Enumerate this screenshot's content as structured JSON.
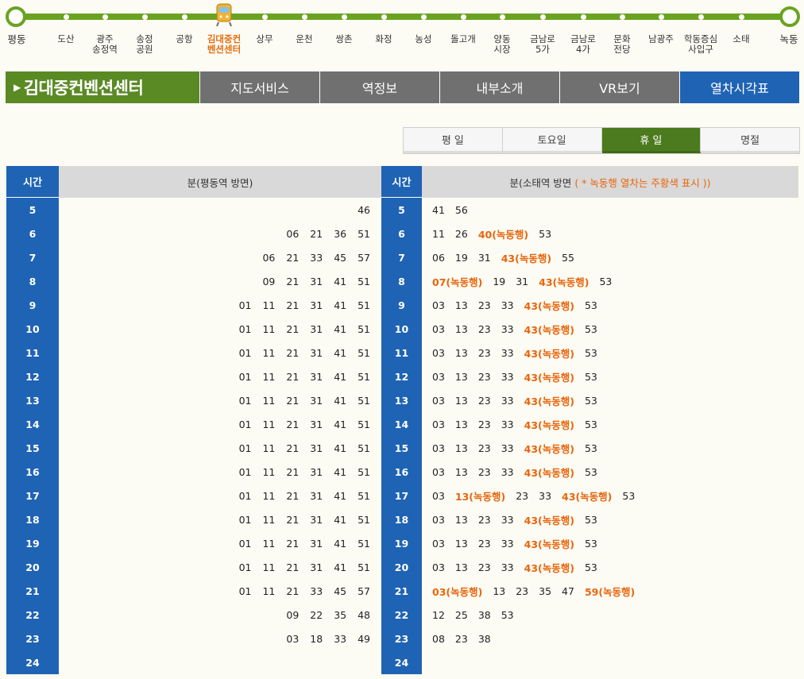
{
  "route": {
    "stations": [
      {
        "name": "평동",
        "end": true
      },
      {
        "name": "도산"
      },
      {
        "name": "광주\n송정역"
      },
      {
        "name": "송정\n공원"
      },
      {
        "name": "공항"
      },
      {
        "name": "김대중컨\n벤션센터",
        "current": true
      },
      {
        "name": "상무"
      },
      {
        "name": "운천"
      },
      {
        "name": "쌍촌"
      },
      {
        "name": "화정"
      },
      {
        "name": "농성"
      },
      {
        "name": "돌고개"
      },
      {
        "name": "양동\n시장"
      },
      {
        "name": "금남로\n5가"
      },
      {
        "name": "금남로\n4가"
      },
      {
        "name": "문화\n전당"
      },
      {
        "name": "남광주"
      },
      {
        "name": "학동증심\n사입구"
      },
      {
        "name": "소태"
      },
      {
        "name": "녹동",
        "end": true
      }
    ],
    "line_color": "#6aa321",
    "current_color": "#e46d0f"
  },
  "tabbar": {
    "station_title": "김대중컨벤션센터",
    "tabs": [
      {
        "label": "지도서비스"
      },
      {
        "label": "역정보"
      },
      {
        "label": "내부소개"
      },
      {
        "label": "VR보기"
      },
      {
        "label": "열차시각표",
        "active": true
      }
    ]
  },
  "days": [
    {
      "label": "평 일"
    },
    {
      "label": "토요일"
    },
    {
      "label": "휴 일",
      "active": true
    },
    {
      "label": "명절"
    }
  ],
  "left_table": {
    "hour_header": "시간",
    "min_header": "분(평동역 방면)",
    "rows": [
      {
        "hour": "5",
        "mins": [
          "46"
        ]
      },
      {
        "hour": "6",
        "mins": [
          "06",
          "21",
          "36",
          "51"
        ]
      },
      {
        "hour": "7",
        "mins": [
          "06",
          "21",
          "33",
          "45",
          "57"
        ]
      },
      {
        "hour": "8",
        "mins": [
          "09",
          "21",
          "31",
          "41",
          "51"
        ]
      },
      {
        "hour": "9",
        "mins": [
          "01",
          "11",
          "21",
          "31",
          "41",
          "51"
        ]
      },
      {
        "hour": "10",
        "mins": [
          "01",
          "11",
          "21",
          "31",
          "41",
          "51"
        ]
      },
      {
        "hour": "11",
        "mins": [
          "01",
          "11",
          "21",
          "31",
          "41",
          "51"
        ]
      },
      {
        "hour": "12",
        "mins": [
          "01",
          "11",
          "21",
          "31",
          "41",
          "51"
        ]
      },
      {
        "hour": "13",
        "mins": [
          "01",
          "11",
          "21",
          "31",
          "41",
          "51"
        ]
      },
      {
        "hour": "14",
        "mins": [
          "01",
          "11",
          "21",
          "31",
          "41",
          "51"
        ]
      },
      {
        "hour": "15",
        "mins": [
          "01",
          "11",
          "21",
          "31",
          "41",
          "51"
        ]
      },
      {
        "hour": "16",
        "mins": [
          "01",
          "11",
          "21",
          "31",
          "41",
          "51"
        ]
      },
      {
        "hour": "17",
        "mins": [
          "01",
          "11",
          "21",
          "31",
          "41",
          "51"
        ]
      },
      {
        "hour": "18",
        "mins": [
          "01",
          "11",
          "21",
          "31",
          "41",
          "51"
        ]
      },
      {
        "hour": "19",
        "mins": [
          "01",
          "11",
          "21",
          "31",
          "41",
          "51"
        ]
      },
      {
        "hour": "20",
        "mins": [
          "01",
          "11",
          "21",
          "31",
          "41",
          "51"
        ]
      },
      {
        "hour": "21",
        "mins": [
          "01",
          "11",
          "21",
          "33",
          "45",
          "57"
        ]
      },
      {
        "hour": "22",
        "mins": [
          "09",
          "22",
          "35",
          "48"
        ]
      },
      {
        "hour": "23",
        "mins": [
          "03",
          "18",
          "33",
          "49"
        ]
      },
      {
        "hour": "24",
        "mins": []
      }
    ]
  },
  "right_table": {
    "hour_header": "시간",
    "min_header": "분(소태역 방면",
    "min_header_note": "( * 녹동행 열차는 주황색 표시 ))",
    "rows": [
      {
        "hour": "5",
        "mins": [
          {
            "t": "41"
          },
          {
            "t": "56"
          }
        ]
      },
      {
        "hour": "6",
        "mins": [
          {
            "t": "11"
          },
          {
            "t": "26"
          },
          {
            "t": "40(녹동행)",
            "hl": true
          },
          {
            "t": "53"
          }
        ]
      },
      {
        "hour": "7",
        "mins": [
          {
            "t": "06"
          },
          {
            "t": "19"
          },
          {
            "t": "31"
          },
          {
            "t": "43(녹동행)",
            "hl": true
          },
          {
            "t": "55"
          }
        ]
      },
      {
        "hour": "8",
        "mins": [
          {
            "t": "07(녹동행)",
            "hl": true
          },
          {
            "t": "19"
          },
          {
            "t": "31"
          },
          {
            "t": "43(녹동행)",
            "hl": true
          },
          {
            "t": "53"
          }
        ]
      },
      {
        "hour": "9",
        "mins": [
          {
            "t": "03"
          },
          {
            "t": "13"
          },
          {
            "t": "23"
          },
          {
            "t": "33"
          },
          {
            "t": "43(녹동행)",
            "hl": true
          },
          {
            "t": "53"
          }
        ]
      },
      {
        "hour": "10",
        "mins": [
          {
            "t": "03"
          },
          {
            "t": "13"
          },
          {
            "t": "23"
          },
          {
            "t": "33"
          },
          {
            "t": "43(녹동행)",
            "hl": true
          },
          {
            "t": "53"
          }
        ]
      },
      {
        "hour": "11",
        "mins": [
          {
            "t": "03"
          },
          {
            "t": "13"
          },
          {
            "t": "23"
          },
          {
            "t": "33"
          },
          {
            "t": "43(녹동행)",
            "hl": true
          },
          {
            "t": "53"
          }
        ]
      },
      {
        "hour": "12",
        "mins": [
          {
            "t": "03"
          },
          {
            "t": "13"
          },
          {
            "t": "23"
          },
          {
            "t": "33"
          },
          {
            "t": "43(녹동행)",
            "hl": true
          },
          {
            "t": "53"
          }
        ]
      },
      {
        "hour": "13",
        "mins": [
          {
            "t": "03"
          },
          {
            "t": "13"
          },
          {
            "t": "23"
          },
          {
            "t": "33"
          },
          {
            "t": "43(녹동행)",
            "hl": true
          },
          {
            "t": "53"
          }
        ]
      },
      {
        "hour": "14",
        "mins": [
          {
            "t": "03"
          },
          {
            "t": "13"
          },
          {
            "t": "23"
          },
          {
            "t": "33"
          },
          {
            "t": "43(녹동행)",
            "hl": true
          },
          {
            "t": "53"
          }
        ]
      },
      {
        "hour": "15",
        "mins": [
          {
            "t": "03"
          },
          {
            "t": "13"
          },
          {
            "t": "23"
          },
          {
            "t": "33"
          },
          {
            "t": "43(녹동행)",
            "hl": true
          },
          {
            "t": "53"
          }
        ]
      },
      {
        "hour": "16",
        "mins": [
          {
            "t": "03"
          },
          {
            "t": "13"
          },
          {
            "t": "23"
          },
          {
            "t": "33"
          },
          {
            "t": "43(녹동행)",
            "hl": true
          },
          {
            "t": "53"
          }
        ]
      },
      {
        "hour": "17",
        "mins": [
          {
            "t": "03"
          },
          {
            "t": "13(녹동행)",
            "hl": true
          },
          {
            "t": "23"
          },
          {
            "t": "33"
          },
          {
            "t": "43(녹동행)",
            "hl": true
          },
          {
            "t": "53"
          }
        ]
      },
      {
        "hour": "18",
        "mins": [
          {
            "t": "03"
          },
          {
            "t": "13"
          },
          {
            "t": "23"
          },
          {
            "t": "33"
          },
          {
            "t": "43(녹동행)",
            "hl": true
          },
          {
            "t": "53"
          }
        ]
      },
      {
        "hour": "19",
        "mins": [
          {
            "t": "03"
          },
          {
            "t": "13"
          },
          {
            "t": "23"
          },
          {
            "t": "33"
          },
          {
            "t": "43(녹동행)",
            "hl": true
          },
          {
            "t": "53"
          }
        ]
      },
      {
        "hour": "20",
        "mins": [
          {
            "t": "03"
          },
          {
            "t": "13"
          },
          {
            "t": "23"
          },
          {
            "t": "33"
          },
          {
            "t": "43(녹동행)",
            "hl": true
          },
          {
            "t": "53"
          }
        ]
      },
      {
        "hour": "21",
        "mins": [
          {
            "t": "03(녹동행)",
            "hl": true
          },
          {
            "t": "13"
          },
          {
            "t": "23"
          },
          {
            "t": "35"
          },
          {
            "t": "47"
          },
          {
            "t": "59(녹동행)",
            "hl": true
          }
        ]
      },
      {
        "hour": "22",
        "mins": [
          {
            "t": "12"
          },
          {
            "t": "25"
          },
          {
            "t": "38"
          },
          {
            "t": "53"
          }
        ]
      },
      {
        "hour": "23",
        "mins": [
          {
            "t": "08"
          },
          {
            "t": "23"
          },
          {
            "t": "38"
          }
        ]
      },
      {
        "hour": "24",
        "mins": []
      }
    ]
  },
  "colors": {
    "green": "#5a8a24",
    "blue": "#1f63b4",
    "gray": "#707070",
    "orange": "#e8650c"
  }
}
